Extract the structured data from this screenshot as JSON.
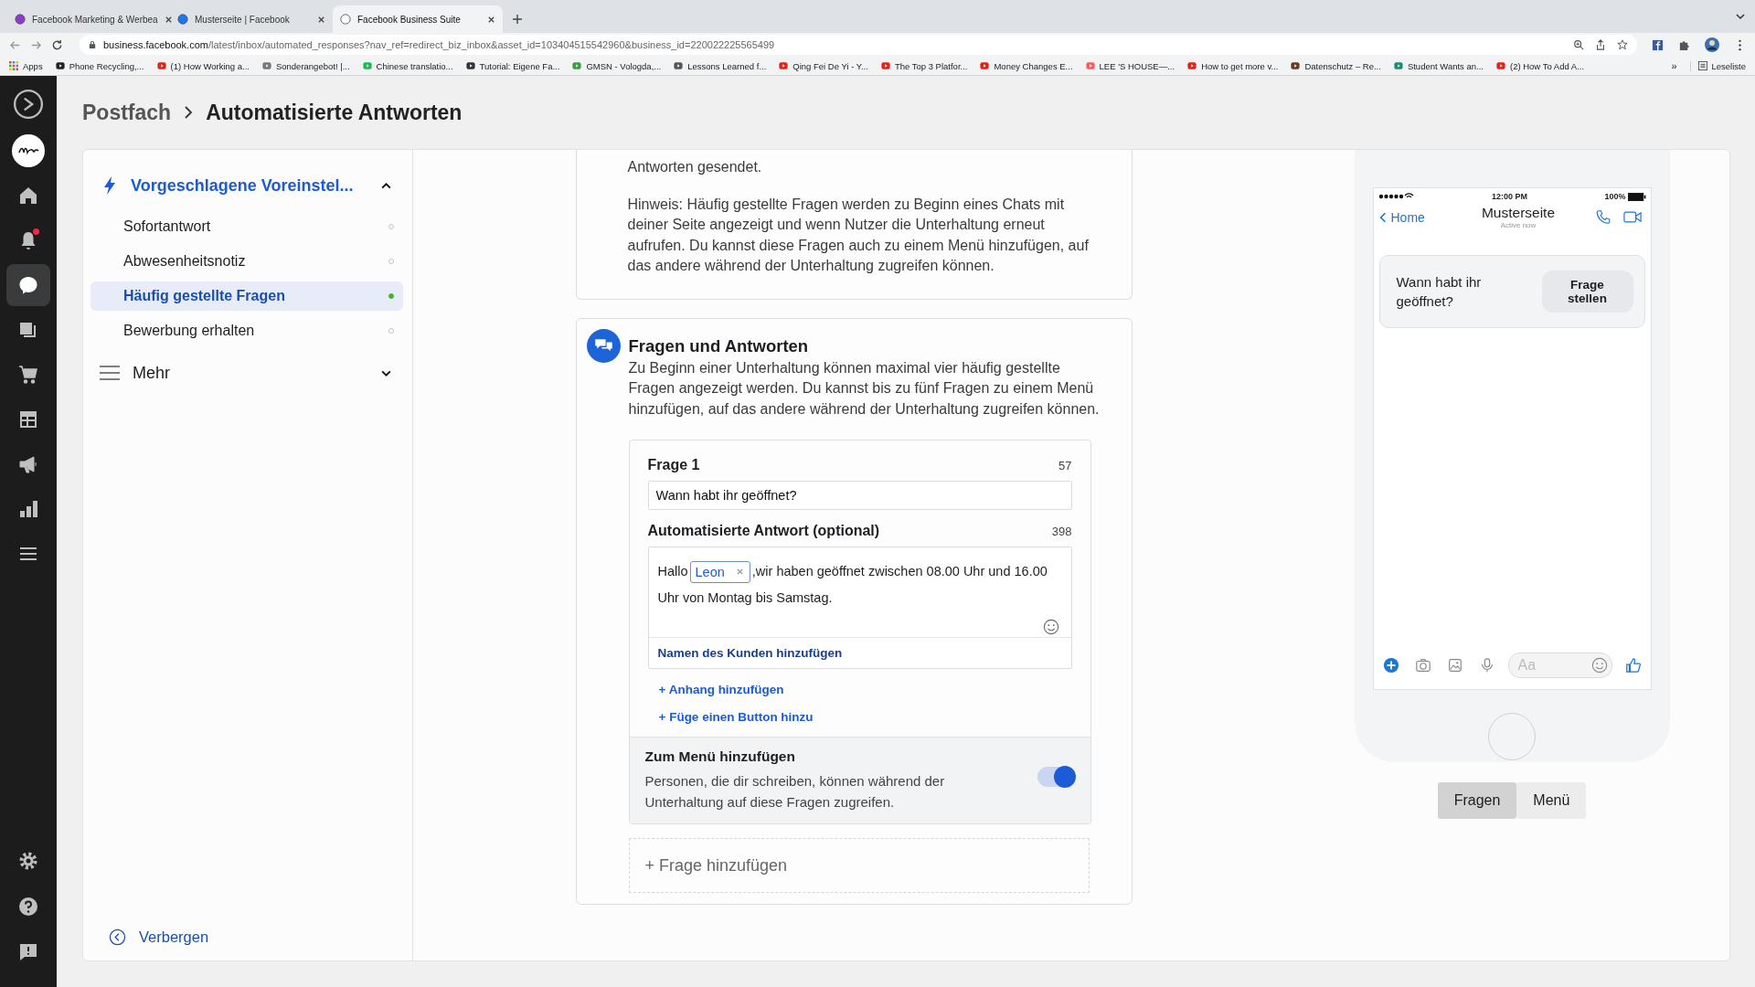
{
  "browser": {
    "tabs": [
      {
        "title": "Facebook Marketing & Werbea",
        "selected": false
      },
      {
        "title": "Musterseite | Facebook",
        "selected": false
      },
      {
        "title": "Facebook Business Suite",
        "selected": true
      }
    ],
    "url_host": "business.facebook.com",
    "url_path": "/latest/inbox/automated_responses?nav_ref=redirect_biz_inbox&asset_id=103404515542960&business_id=220022225565499",
    "bookmarks": [
      "Apps",
      "Phone Recycling,...",
      "(1) How Working a...",
      "Sonderangebot! |...",
      "Chinese translatio...",
      "Tutorial: Eigene Fa...",
      "GMSN - Vologda,...",
      "Lessons Learned f...",
      "Qing Fei De Yi - Y...",
      "The Top 3 Platfor...",
      "Money Changes E...",
      "LEE 'S HOUSE—...",
      "How to get more v...",
      "Datenschutz – Re...",
      "Student Wants an...",
      "(2) How To Add A..."
    ],
    "bookmarks_more": "»",
    "reading_list": "Leseliste"
  },
  "rail": {
    "items": [
      {
        "selected": false,
        "notification": false
      },
      {
        "selected": false,
        "notification": true
      },
      {
        "selected": true,
        "notification": false
      },
      {
        "selected": false,
        "notification": false
      },
      {
        "selected": false,
        "notification": false
      },
      {
        "selected": false,
        "notification": false
      },
      {
        "selected": false,
        "notification": false
      },
      {
        "selected": false,
        "notification": false
      },
      {
        "selected": false,
        "notification": false
      }
    ]
  },
  "breadcrumb": [
    "Postfach",
    "Automatisierte Antworten"
  ],
  "nav": {
    "title": "Vorgeschlagene Voreinstel...",
    "expanded": true,
    "items": [
      {
        "label": "Sofortantwort",
        "selected": false,
        "active": false
      },
      {
        "label": "Abwesenheitsnotiz",
        "selected": false,
        "active": false
      },
      {
        "label": "Häufig gestellte Fragen",
        "selected": true,
        "active": true
      },
      {
        "label": "Bewerbung erhalten",
        "selected": false,
        "active": false
      }
    ],
    "more": {
      "label": "Mehr",
      "expanded": false
    },
    "hide": "Verbergen"
  },
  "intro": [
    "Antworten gesendet.",
    "Hinweis: Häufig gestellte Fragen werden zu Beginn eines Chats mit deiner Seite angezeigt und wenn Nutzer die Unterhaltung erneut aufrufen. Du kannst diese Fragen auch zu einem Menü hinzufügen, auf das andere während der Unterhaltung zugreifen können."
  ],
  "qa": {
    "title": "Fragen und Antworten",
    "description": "Zu Beginn einer Unterhaltung können maximal vier häufig gestellte Fragen angezeigt werden. Du kannst bis zu fünf Fragen zu einem Menü hinzufügen, auf das andere während der Unterhaltung zugreifen können.",
    "question": {
      "label": "Frage 1",
      "count": "57",
      "value": "Wann habt ihr geöffnet?"
    },
    "answer": {
      "label": "Automatisierte Antwort (optional)",
      "count": "398",
      "before": "Hallo",
      "chip": "Leon",
      "after": [
        ",wir haben geöffnet zwischen 08.00 Uhr und 16.00",
        "Uhr von Montag bis Samstag."
      ],
      "name_link": "Namen des Kunden hinzufügen"
    },
    "actions": [
      "+ Anhang hinzufügen",
      "+ Füge einen Button hinzu"
    ],
    "menu": {
      "title": "Zum Menü hinzufügen",
      "description": "Personen, die dir schreiben, können während der Unterhaltung auf diese Fragen zugreifen.",
      "on": true
    },
    "add": "+ Frage hinzufügen"
  },
  "phone": {
    "time": "12:00 PM",
    "battery": "100%",
    "back": "Home",
    "title": "Musterseite",
    "subtitle": "Active now",
    "question": "Wann habt ihr geöffnet?",
    "ask": "Frage stellen",
    "composer_placeholder": "Aa"
  },
  "preview_tabs": [
    {
      "label": "Fragen",
      "selected": true
    },
    {
      "label": "Menü",
      "selected": false
    }
  ]
}
